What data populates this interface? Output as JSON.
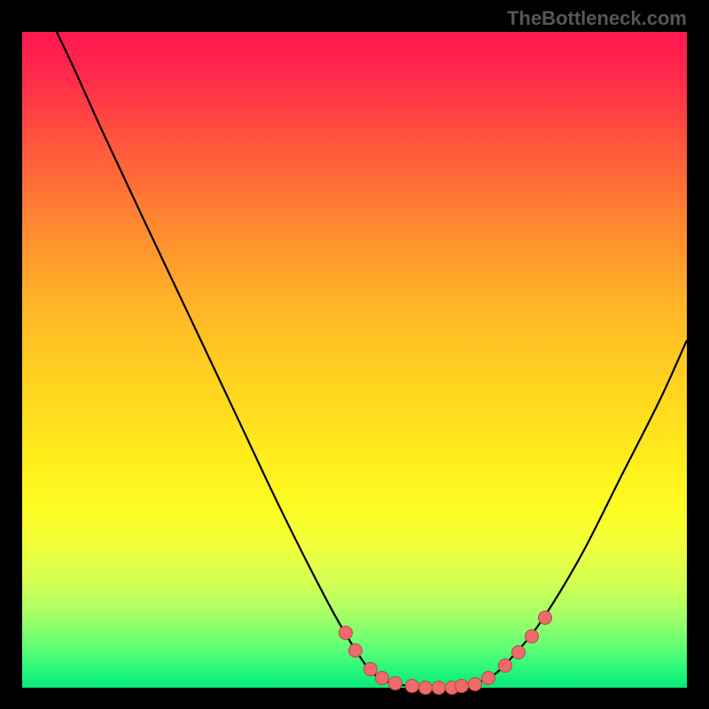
{
  "watermark": "TheBottleneck.com",
  "colors": {
    "marker": "#ee6a6b",
    "curve": "#000000"
  },
  "chart_data": {
    "type": "line",
    "title": "",
    "xlabel": "",
    "ylabel": "",
    "xlim": [
      0,
      100
    ],
    "ylim": [
      0,
      100
    ],
    "curve": [
      {
        "x": 5.2,
        "y": 100.0
      },
      {
        "x": 8.0,
        "y": 94.0
      },
      {
        "x": 12.0,
        "y": 85.0
      },
      {
        "x": 18.0,
        "y": 72.0
      },
      {
        "x": 25.0,
        "y": 57.0
      },
      {
        "x": 32.0,
        "y": 42.0
      },
      {
        "x": 39.0,
        "y": 27.0
      },
      {
        "x": 46.0,
        "y": 13.0
      },
      {
        "x": 50.0,
        "y": 6.0
      },
      {
        "x": 53.0,
        "y": 2.0
      },
      {
        "x": 56.0,
        "y": 0.6
      },
      {
        "x": 60.0,
        "y": 0.2
      },
      {
        "x": 64.0,
        "y": 0.2
      },
      {
        "x": 68.0,
        "y": 0.7
      },
      {
        "x": 71.0,
        "y": 2.0
      },
      {
        "x": 74.0,
        "y": 5.0
      },
      {
        "x": 78.0,
        "y": 10.0
      },
      {
        "x": 84.0,
        "y": 20.0
      },
      {
        "x": 90.0,
        "y": 32.0
      },
      {
        "x": 96.0,
        "y": 44.0
      },
      {
        "x": 100.0,
        "y": 53.0
      }
    ],
    "markers": [
      {
        "x": 48.5,
        "y": 8.5
      },
      {
        "x": 50.0,
        "y": 5.8
      },
      {
        "x": 52.3,
        "y": 3.0
      },
      {
        "x": 54.0,
        "y": 1.6
      },
      {
        "x": 56.0,
        "y": 0.8
      },
      {
        "x": 58.5,
        "y": 0.4
      },
      {
        "x": 60.5,
        "y": 0.2
      },
      {
        "x": 62.5,
        "y": 0.2
      },
      {
        "x": 64.5,
        "y": 0.2
      },
      {
        "x": 66.0,
        "y": 0.4
      },
      {
        "x": 68.0,
        "y": 0.7
      },
      {
        "x": 70.0,
        "y": 1.6
      },
      {
        "x": 72.5,
        "y": 3.5
      },
      {
        "x": 74.5,
        "y": 5.5
      },
      {
        "x": 76.5,
        "y": 8.0
      },
      {
        "x": 78.5,
        "y": 10.8
      }
    ]
  }
}
